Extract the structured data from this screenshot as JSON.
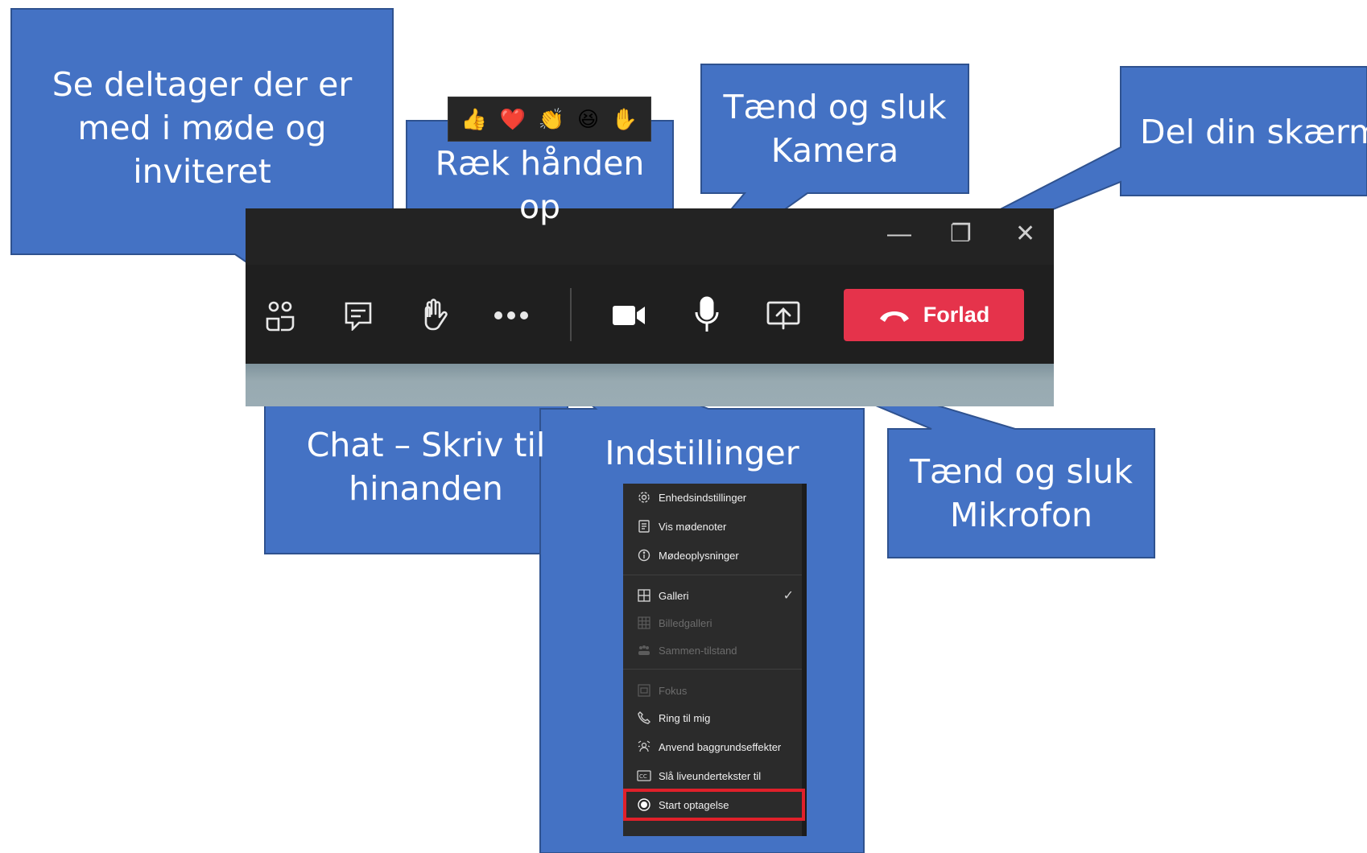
{
  "window": {
    "minimize": "—",
    "restore": "❐",
    "close": "✕"
  },
  "toolbar": {
    "participants_icon": "people-icon",
    "chat_icon": "chat-icon",
    "raise_hand_icon": "hand-icon",
    "more_icon": "more-icon",
    "camera_icon": "camera-icon",
    "mic_icon": "microphone-icon",
    "share_icon": "share-screen-icon",
    "leave_label": "Forlad",
    "leave_color": "#e5334b"
  },
  "reactions": [
    "👍",
    "❤️",
    "👏",
    "😆",
    "✋"
  ],
  "callouts": {
    "participants": [
      "Se deltager der er",
      "med i møde og",
      "inviteret"
    ],
    "raise_hand": [
      "Ræk hånden",
      "op"
    ],
    "camera": [
      "Tænd og sluk",
      "Kamera"
    ],
    "share": [
      "Del din skærm"
    ],
    "chat": [
      "Chat – Skriv til",
      "hinanden"
    ],
    "settings": [
      "Indstillinger"
    ],
    "mic": [
      "Tænd og sluk",
      "Mikrofon"
    ]
  },
  "menu": {
    "items": [
      {
        "label": "Enhedsindstillinger",
        "icon": "gear-icon",
        "disabled": false
      },
      {
        "label": "Vis mødenoter",
        "icon": "notes-icon",
        "disabled": false
      },
      {
        "label": "Mødeoplysninger",
        "icon": "info-icon",
        "disabled": false
      },
      {
        "label": "Galleri",
        "icon": "grid-icon",
        "disabled": false,
        "checked": true
      },
      {
        "label": "Billedgalleri",
        "icon": "large-grid-icon",
        "disabled": true
      },
      {
        "label": "Sammen-tilstand",
        "icon": "together-icon",
        "disabled": true
      },
      {
        "label": "Fokus",
        "icon": "focus-icon",
        "disabled": true
      },
      {
        "label": "Ring til mig",
        "icon": "phone-icon",
        "disabled": false
      },
      {
        "label": "Anvend baggrundseffekter",
        "icon": "background-effects-icon",
        "disabled": false
      },
      {
        "label": "Slå liveundertekster til",
        "icon": "cc-icon",
        "disabled": false
      },
      {
        "label": "Start optagelse",
        "icon": "record-icon",
        "disabled": false,
        "highlighted": true
      }
    ],
    "check_mark": "✓"
  },
  "colors": {
    "callout": "#4472c4",
    "callout_border": "#2f528f",
    "highlight": "#e0202a"
  }
}
